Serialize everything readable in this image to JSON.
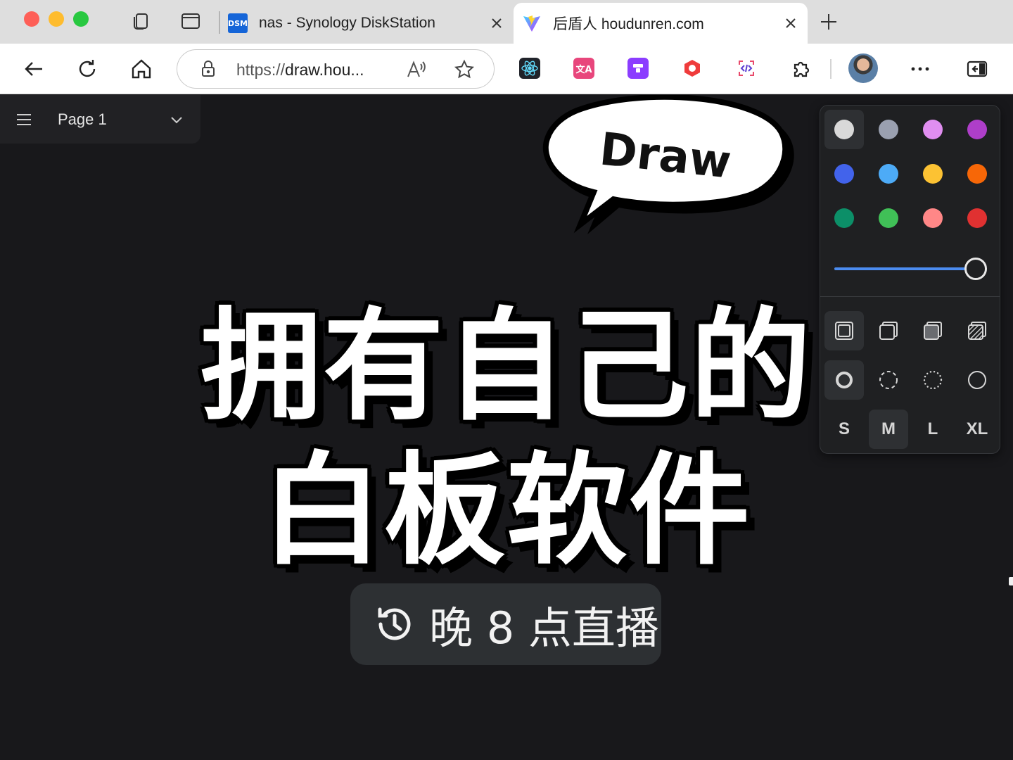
{
  "browser": {
    "tabs": [
      {
        "title": "nas - Synology DiskStation",
        "favicon": "DSM",
        "active": false
      },
      {
        "title": "后盾人 houdunren.com",
        "favicon": "vite-icon",
        "active": true
      }
    ],
    "url_prefix": "https://",
    "url_host": "draw.hou...",
    "icons": [
      "back-icon",
      "refresh-icon",
      "home-icon",
      "lock-icon",
      "read-aloud-icon",
      "favorite-star-icon",
      "react-devtools-icon",
      "translate-icon",
      "extension-purple-icon",
      "extension-red-icon",
      "dev-tools-icon",
      "extensions-puzzle-icon",
      "more-icon",
      "sidebar-icon"
    ]
  },
  "canvas": {
    "page_name": "Page 1",
    "bubble_text": "Draw",
    "headline_line1": "拥有自己的",
    "headline_line2": "白板软件",
    "live_text": "晚 8 点直播"
  },
  "style_panel": {
    "colors": [
      "#d9d9d9",
      "#9aa0b0",
      "#e08ef0",
      "#ae3ec9",
      "#4263eb",
      "#4dabf7",
      "#fcc233",
      "#f76707",
      "#0c8f68",
      "#40c057",
      "#ff8787",
      "#e03131"
    ],
    "selected_color": "#d9d9d9",
    "opacity_value": 1.0,
    "fill_options": [
      "fill-none-icon",
      "fill-semi-icon",
      "fill-solid-icon",
      "fill-pattern-icon"
    ],
    "dash_options": [
      "dash-draw-icon",
      "dash-dashed-icon",
      "dash-dotted-icon",
      "dash-solid-icon"
    ],
    "sizes": [
      "S",
      "M",
      "L",
      "XL"
    ],
    "selected_size": "M"
  },
  "colors": {
    "accent": "#4b8cf0",
    "canvas_bg": "#18181b",
    "panel_bg": "#1f2022"
  }
}
